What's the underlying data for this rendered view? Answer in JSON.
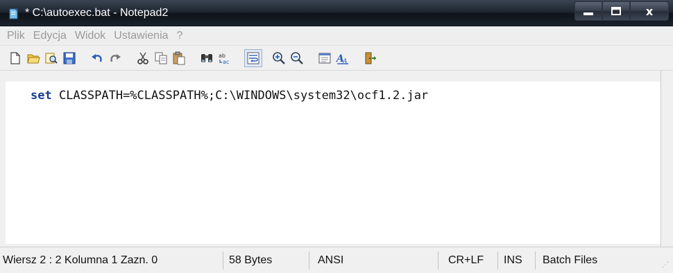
{
  "window": {
    "title": "* C:\\autoexec.bat - Notepad2",
    "caption_buttons": {
      "minimize": "minimize-icon",
      "maximize": "maximize-icon",
      "close": "x"
    }
  },
  "menu": {
    "items": [
      "Plik",
      "Edycja",
      "Widok",
      "Ustawienia",
      "?"
    ]
  },
  "toolbar": {
    "buttons": [
      "new-file-icon",
      "open-folder-icon",
      "browse-icon",
      "save-icon",
      "undo-icon",
      "redo-icon",
      "cut-icon",
      "copy-icon",
      "paste-icon",
      "find-icon",
      "replace-icon",
      "word-wrap-icon",
      "zoom-in-icon",
      "zoom-out-icon",
      "select-scheme-icon",
      "font-icon",
      "exit-icon"
    ],
    "pressed": "word-wrap-icon"
  },
  "editor": {
    "keyword": "set",
    "line_rest": " CLASSPATH=%CLASSPATH%;C:\\WINDOWS\\system32\\ocf1.2.jar",
    "keyword_color": "#1a3d8f"
  },
  "status": {
    "position": "Wiersz 2 : 2  Kolumna 1  Zazn. 0",
    "size": "58 Bytes",
    "encoding": "ANSI",
    "line_endings": "CR+LF",
    "insert_mode": "INS",
    "scheme": "Batch Files"
  }
}
